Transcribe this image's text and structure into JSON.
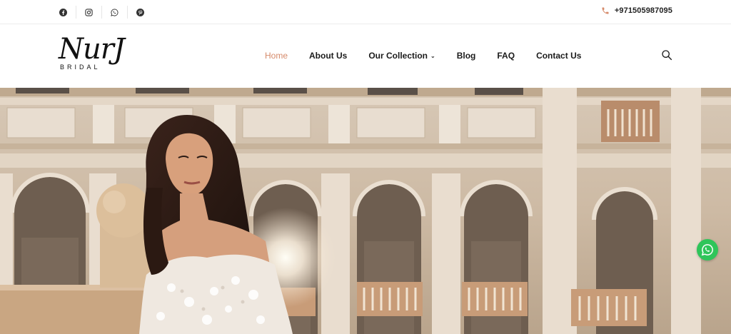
{
  "topbar": {
    "social_icons": [
      "facebook-icon",
      "instagram-icon",
      "whatsapp-icon",
      "pinterest-icon"
    ],
    "phone": "+971505987095"
  },
  "logo": {
    "script": "NurJ",
    "sub": "BRIDAL"
  },
  "nav": {
    "items": [
      {
        "label": "Home",
        "active": true
      },
      {
        "label": "About Us"
      },
      {
        "label": "Our Collection",
        "has_dropdown": true
      },
      {
        "label": "Blog"
      },
      {
        "label": "FAQ"
      },
      {
        "label": "Contact Us"
      }
    ],
    "search_icon": "search-icon"
  },
  "hero": {
    "subject": "bride-in-lace-gown-palace-courtyard"
  },
  "floating": {
    "icon": "whatsapp-icon"
  },
  "colors": {
    "accent": "#d68a6a",
    "whatsapp": "#2fc55a"
  }
}
